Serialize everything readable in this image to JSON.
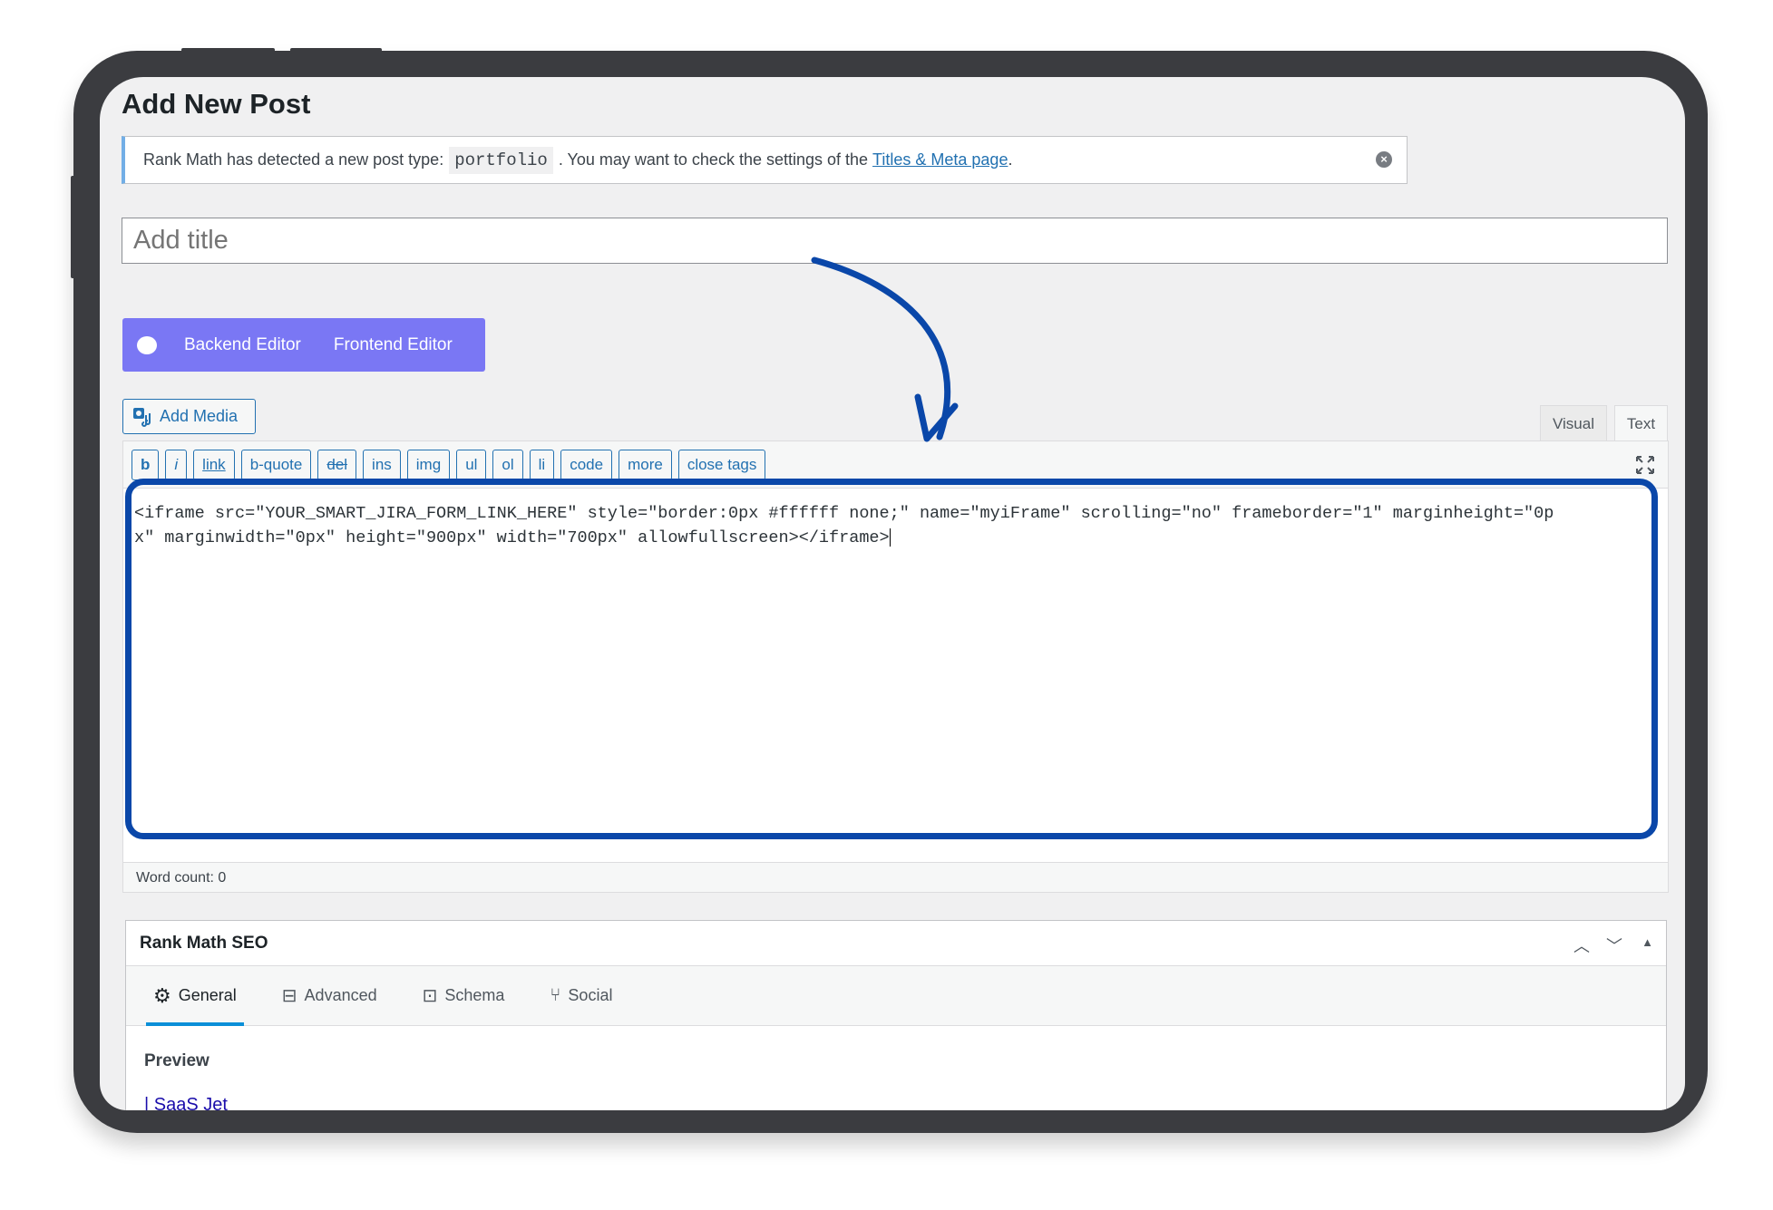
{
  "page": {
    "title": "Add New Post"
  },
  "notice": {
    "text_before": "Rank Math has detected a new post type:",
    "post_type": "portfolio",
    "text_after": ". You may want to check the settings of the",
    "link": "Titles & Meta page",
    "period": "."
  },
  "title_input": {
    "placeholder": "Add title"
  },
  "builder": {
    "backend": "Backend Editor",
    "frontend": "Frontend Editor",
    "color": "#7a77f4"
  },
  "editor": {
    "add_media": "Add Media",
    "tabs": [
      "Visual",
      "Text"
    ],
    "active_tab": "Text",
    "toolbar": [
      "b",
      "i",
      "link",
      "b-quote",
      "del",
      "ins",
      "img",
      "ul",
      "ol",
      "li",
      "code",
      "more",
      "close tags"
    ],
    "content": "<iframe src=\"YOUR_SMART_JIRA_FORM_LINK_HERE\" style=\"border:0px #ffffff none;\" name=\"myiFrame\" scrolling=\"no\" frameborder=\"1\" marginheight=\"0px\" marginwidth=\"0px\" height=\"900px\" width=\"700px\" allowfullscreen></iframe>",
    "word_count": "Word count: 0",
    "highlight_color": "#0a47a9"
  },
  "rank_math": {
    "title": "Rank Math SEO",
    "tabs": [
      "General",
      "Advanced",
      "Schema",
      "Social"
    ],
    "active_tab": "General",
    "preview_label": "Preview",
    "preview_link": "| SaaS Jet"
  }
}
